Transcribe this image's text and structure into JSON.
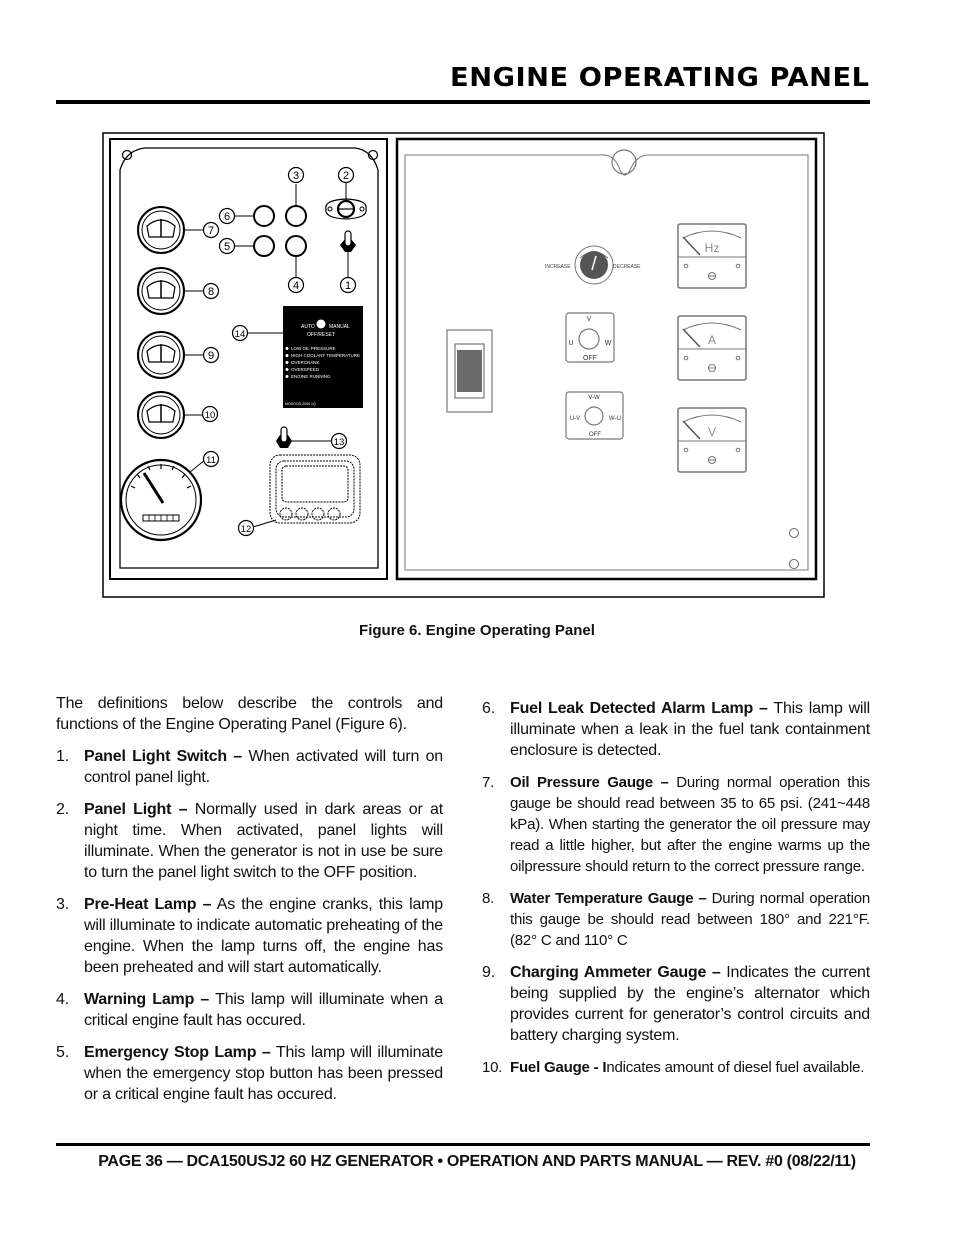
{
  "header": {
    "title": "ENGINE OPERATING PANEL"
  },
  "figure": {
    "caption": "Figure 6. Engine Operating Panel",
    "callouts": [
      "1",
      "2",
      "3",
      "4",
      "5",
      "6",
      "7",
      "8",
      "9",
      "10",
      "11",
      "12",
      "13",
      "14"
    ],
    "controller": {
      "mode_auto": "AUTO",
      "mode_manual": "MANUAL",
      "mode_off": "OFF/RESET",
      "indicators": [
        "LOW OIL PRESSURE",
        "HIGH COOLANT TEMPERATURE",
        "OVERCRANK",
        "OVERSPEED",
        "ENGINE RUNNING"
      ],
      "model": "MODOOD-2000 1Q"
    },
    "governor": {
      "increase": "INCREASE",
      "decrease": "DECREASE"
    },
    "ammeter_switch": {
      "top": "V",
      "left": "U",
      "right": "W",
      "bottom": "OFF"
    },
    "voltmeter_switch": {
      "top": "V-W",
      "left": "U-V",
      "right": "W-U",
      "bottom": "OFF"
    },
    "meters": [
      {
        "unit": "Hz"
      },
      {
        "unit": "A"
      },
      {
        "unit": "V"
      }
    ]
  },
  "body": {
    "intro": "The definitions below describe the controls and functions of the Engine Operating Panel (Figure 6).",
    "items": [
      {
        "num": "1.",
        "label": "Panel Light Switch –",
        "text": " When activated will turn on control panel light."
      },
      {
        "num": "2.",
        "label": "Panel Light –",
        "text": " Normally used in dark areas or at night time. When activated, panel lights will illuminate. When the generator is not in use be sure to turn the panel light switch to the OFF position."
      },
      {
        "num": "3.",
        "label": "Pre-Heat Lamp –",
        "text": " As the engine cranks, this lamp will illuminate to indicate automatic preheating of the engine. When the lamp turns off, the engine has been preheated and will start automatically."
      },
      {
        "num": "4.",
        "label": "Warning Lamp –",
        "text": " This lamp will illuminate when a critical engine fault has occured."
      },
      {
        "num": "5.",
        "label": "Emergency Stop Lamp –",
        "text": " This lamp will illuminate when the emergency stop button has been pressed or a critical engine fault has occured."
      },
      {
        "num": "6.",
        "label": "Fuel Leak Detected Alarm Lamp –",
        "text": " This lamp will illuminate when a leak in the fuel tank containment enclosure is detected."
      },
      {
        "num": "7.",
        "label": "Oil Pressure Gauge –",
        "text": " During normal operation this gauge be should read between 35 to 65 psi. (241~448 kPa). When starting the generator the oil pressure may read a little higher, but after the engine warms up the oilpressure should return to the correct pressure range."
      },
      {
        "num": "8.",
        "label": "Water Temperature Gauge –",
        "text": " During normal operation this gauge be should read between 180° and 221°F. (82° C and 110° C"
      },
      {
        "num": "9.",
        "label": "Charging Ammeter Gauge –",
        "text": " Indicates the current being supplied by the engine’s alternator which provides current for generator’s control circuits and battery charging system."
      },
      {
        "num": "10.",
        "label": "Fuel Gauge - I",
        "text": "ndicates amount of diesel fuel available."
      }
    ]
  },
  "footer": {
    "text": "PAGE 36 — DCA150USJ2 60 HZ GENERATOR • OPERATION AND PARTS MANUAL — REV. #0 (08/22/11)"
  }
}
